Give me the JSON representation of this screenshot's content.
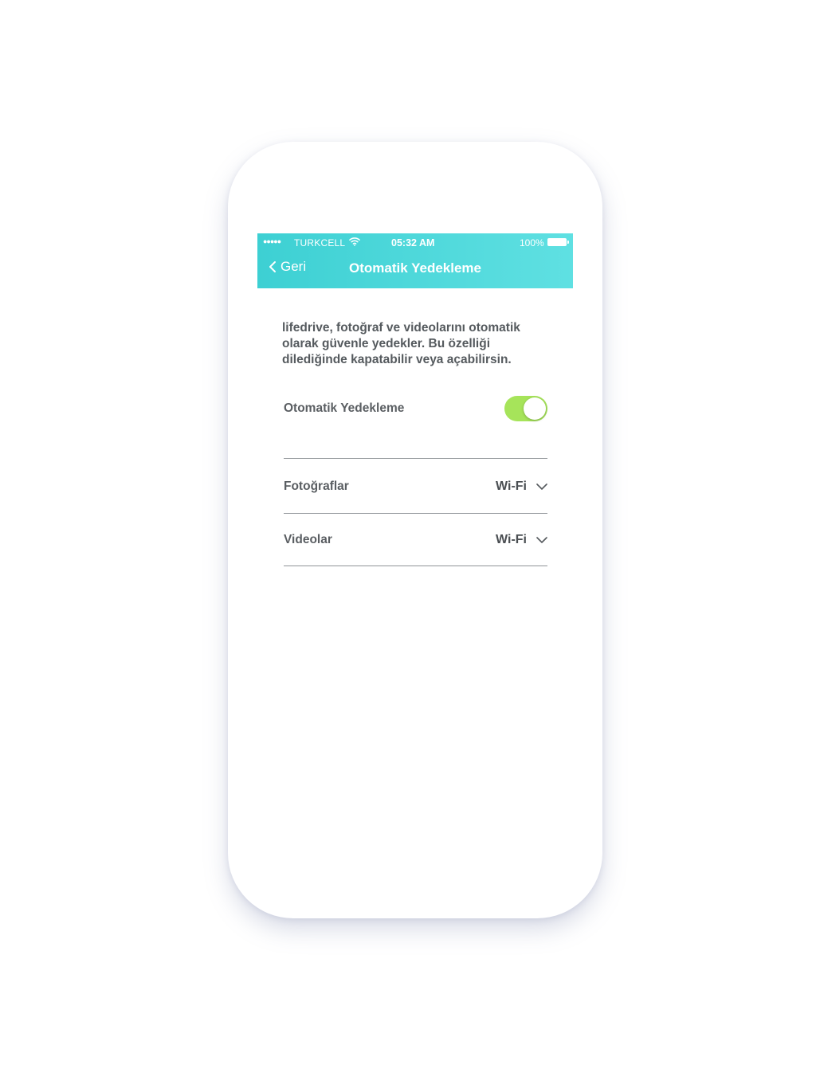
{
  "status_bar": {
    "signal": "●●●●●",
    "carrier": "TURKCELL",
    "time": "05:32 AM",
    "battery": "100%"
  },
  "nav": {
    "back_label": "Geri",
    "title": "Otomatik Yedekleme"
  },
  "description": "lifedrive, fotoğraf ve videolarını otomatik olarak güvenle yedekler. Bu özelliği dilediğinde kapatabilir veya açabilirsin.",
  "settings": {
    "auto_backup": {
      "label": "Otomatik Yedekleme",
      "enabled": true
    },
    "photos": {
      "label": "Fotoğraflar",
      "value": "Wi-Fi"
    },
    "videos": {
      "label": "Videolar",
      "value": "Wi-Fi"
    }
  },
  "colors": {
    "header_start": "#3dd0d3",
    "header_end": "#5fe0e2",
    "toggle_on": "#a6e45a",
    "text": "#555a5e"
  }
}
